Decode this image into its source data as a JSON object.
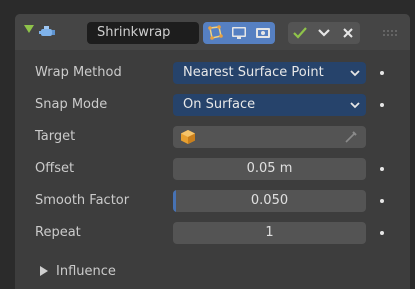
{
  "header": {
    "modifier_name": "Shrinkwrap",
    "modifier_icon": "shrinkwrap-modifier-icon",
    "toggles": [
      "edit-mode-icon",
      "realtime-display-icon",
      "render-icon"
    ],
    "apply_icons": [
      "apply-check-icon",
      "collapse-chevron-icon",
      "delete-x-icon"
    ],
    "accent_color": "#5680c2",
    "apply_color": "#8fc34a"
  },
  "properties": {
    "wrap_method": {
      "label": "Wrap Method",
      "value": "Nearest Surface Point"
    },
    "snap_mode": {
      "label": "Snap Mode",
      "value": "On Surface"
    },
    "target": {
      "label": "Target",
      "value": ""
    },
    "offset": {
      "label": "Offset",
      "value": "0.05 m"
    },
    "smooth_factor": {
      "label": "Smooth Factor",
      "value": "0.050",
      "fraction": 0.05
    },
    "repeat": {
      "label": "Repeat",
      "value": "1"
    }
  },
  "subpanel": {
    "influence_label": "Influence"
  }
}
